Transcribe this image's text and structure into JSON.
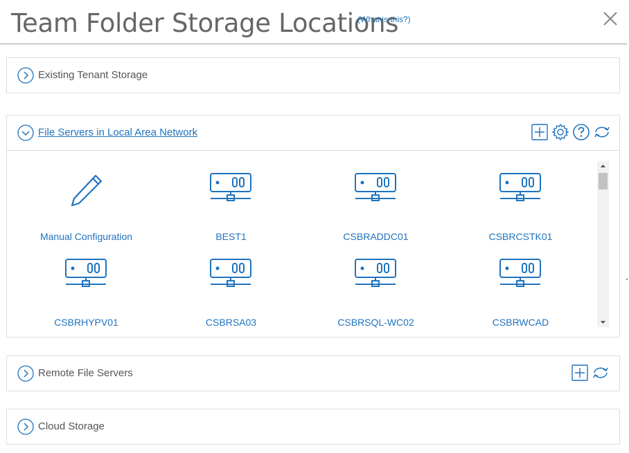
{
  "dialog": {
    "title": "Team Folder Storage Locations",
    "help_link": "(What is this?)"
  },
  "sections": {
    "existing": {
      "label": "Existing Tenant Storage",
      "expanded": false
    },
    "lan": {
      "label": "File Servers in Local Area Network",
      "expanded": true,
      "tools": [
        "add-icon",
        "gear-icon",
        "help-icon",
        "refresh-icon"
      ],
      "items": [
        {
          "label": "Manual Configuration",
          "icon": "pencil-icon"
        },
        {
          "label": "BEST1",
          "icon": "server-icon"
        },
        {
          "label": "CSBRADDC01",
          "icon": "server-icon"
        },
        {
          "label": "CSBRCSTK01",
          "icon": "server-icon"
        },
        {
          "label": "CSBRHYPV01",
          "icon": "server-icon"
        },
        {
          "label": "CSBRSA03",
          "icon": "server-icon"
        },
        {
          "label": "CSBRSQL-WC02",
          "icon": "server-icon"
        },
        {
          "label": "CSBRWCAD",
          "icon": "server-icon"
        }
      ]
    },
    "remote": {
      "label": "Remote File Servers",
      "expanded": false,
      "tools": [
        "add-icon",
        "refresh-icon"
      ]
    },
    "cloud": {
      "label": "Cloud Storage",
      "expanded": false
    }
  },
  "colors": {
    "accent": "#1e73be",
    "text": "#555555",
    "border": "#dcdcdc"
  }
}
